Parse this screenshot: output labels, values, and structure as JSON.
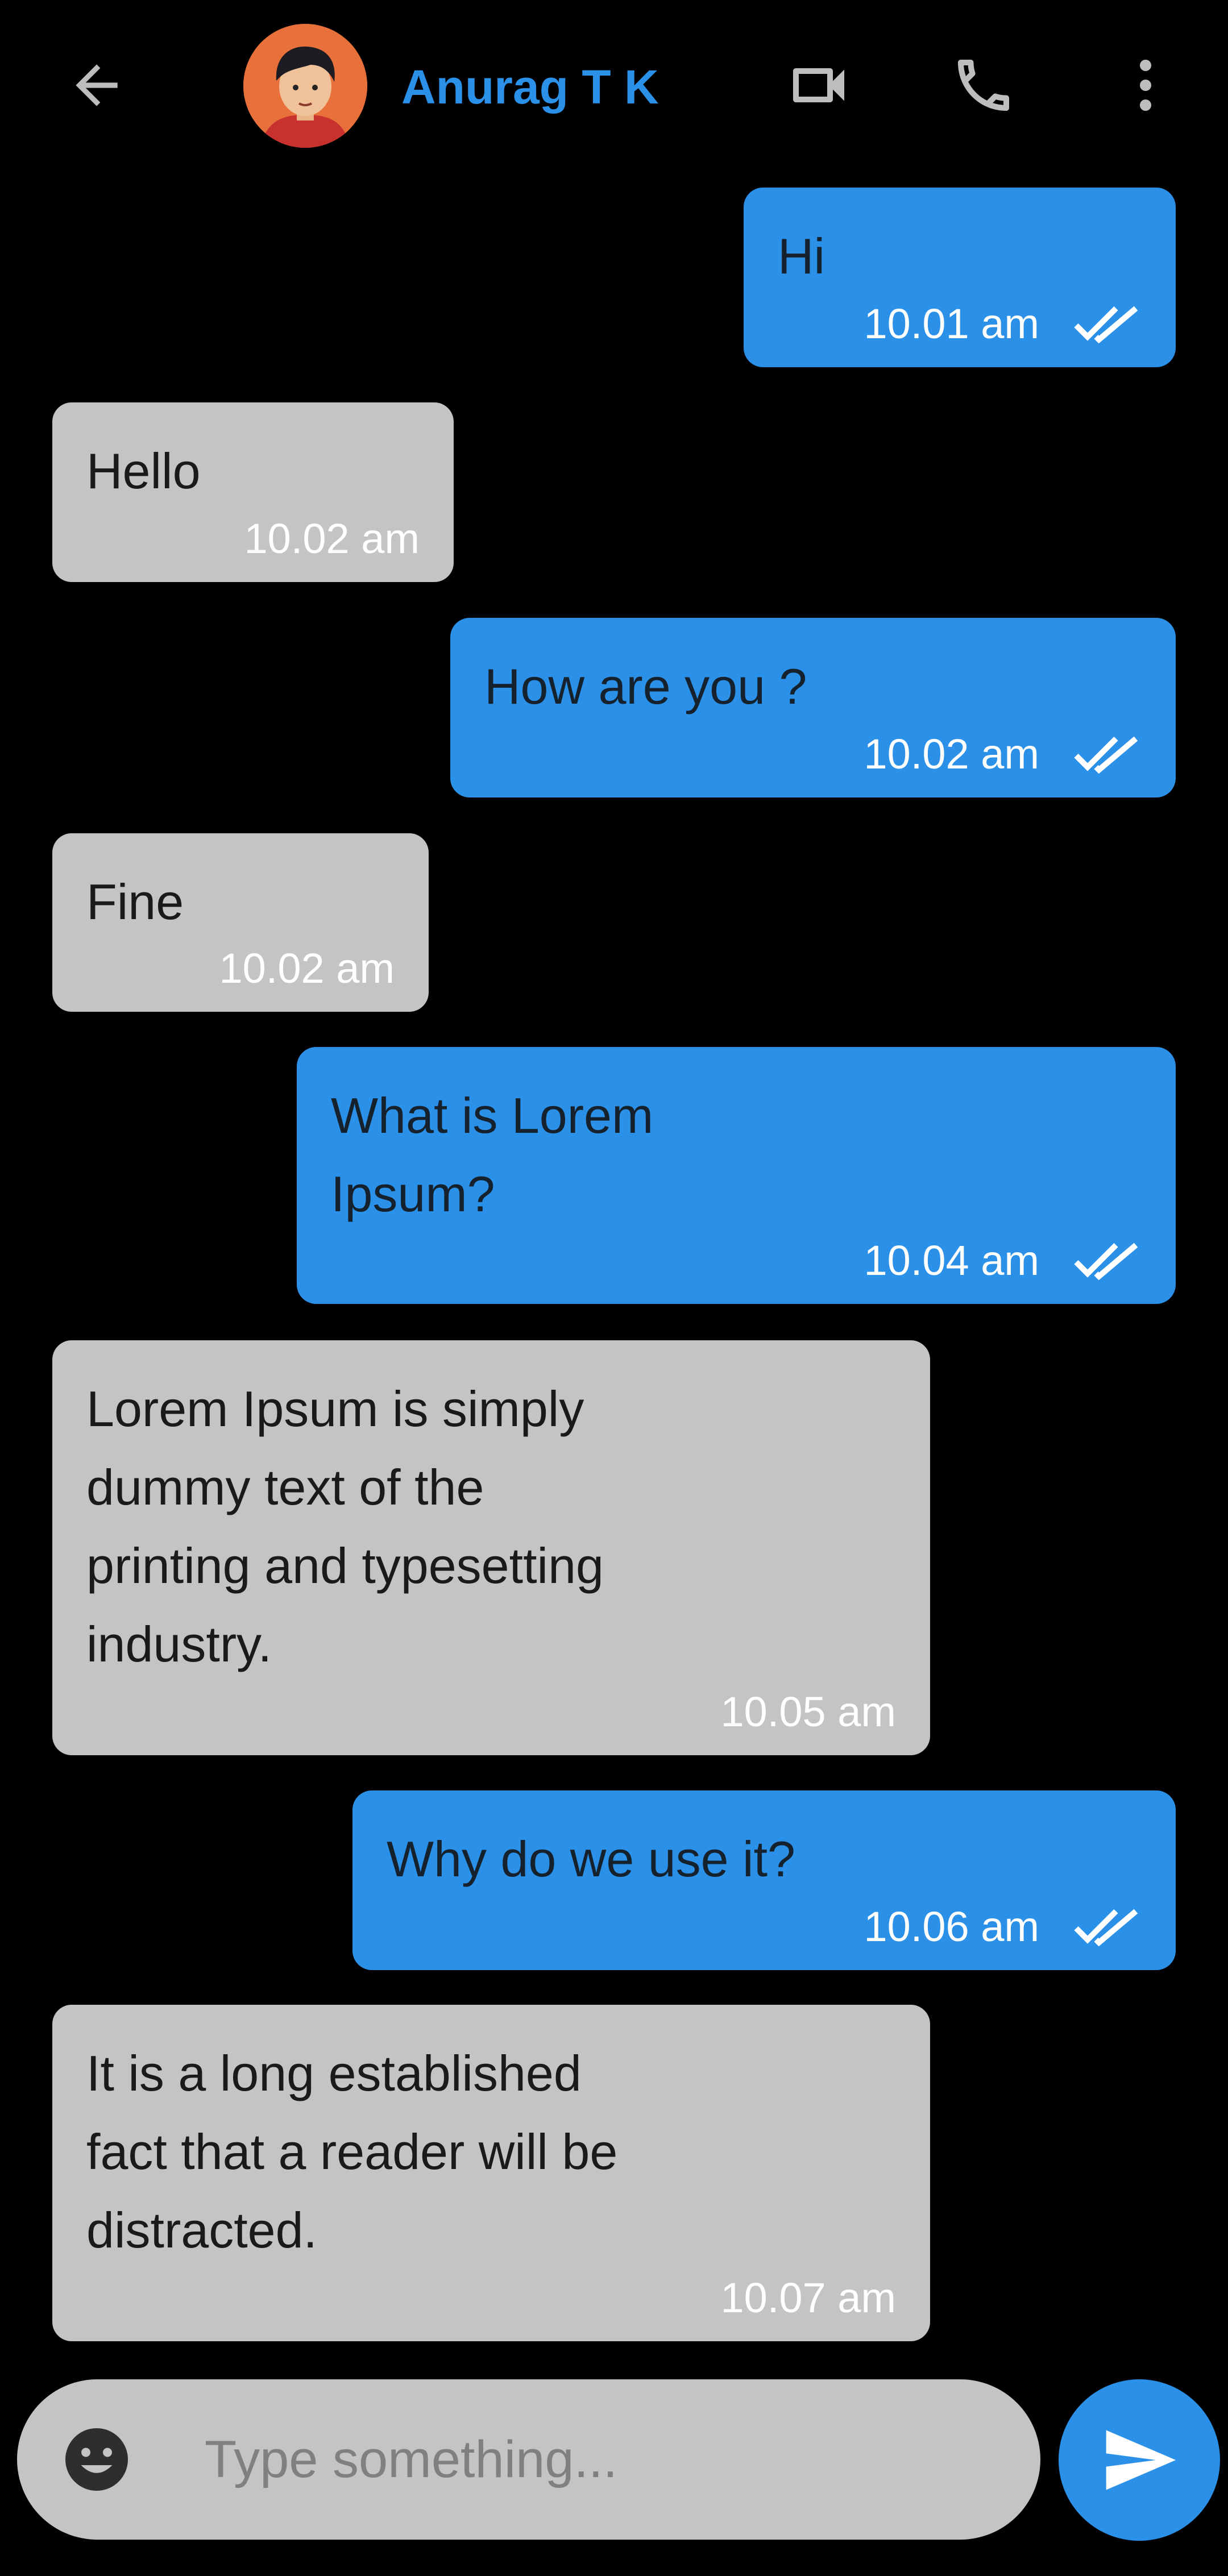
{
  "header": {
    "contact_name": "Anurag T K",
    "accent_color": "#2b90e8",
    "icons": [
      "back-arrow-icon",
      "video-camera-icon",
      "phone-icon",
      "more-vertical-icon"
    ]
  },
  "messages": [
    {
      "direction": "outgoing",
      "lines": [
        "Hi"
      ],
      "time": "10.01 am",
      "status": "read"
    },
    {
      "direction": "incoming",
      "lines": [
        "Hello"
      ],
      "time": "10.02 am"
    },
    {
      "direction": "outgoing",
      "lines": [
        "How are you ?"
      ],
      "time": "10.02 am",
      "status": "read"
    },
    {
      "direction": "incoming",
      "lines": [
        "Fine"
      ],
      "time": "10.02 am"
    },
    {
      "direction": "outgoing",
      "lines": [
        "What is Lorem",
        "Ipsum?"
      ],
      "time": "10.04 am",
      "status": "read"
    },
    {
      "direction": "incoming",
      "lines": [
        "Lorem Ipsum is simply",
        "dummy text of the",
        "printing and typesetting",
        "industry."
      ],
      "time": "10.05 am"
    },
    {
      "direction": "outgoing",
      "lines": [
        "Why do we use it?"
      ],
      "time": "10.06 am",
      "status": "read"
    },
    {
      "direction": "incoming",
      "lines": [
        "It is a long established",
        "fact that a reader will be",
        "distracted."
      ],
      "time": "10.07 am"
    }
  ],
  "composer": {
    "placeholder": "Type something...",
    "value": ""
  },
  "colors": {
    "outgoing_bubble": "#2b90e8",
    "incoming_bubble": "#c4c3c5",
    "background": "#000000"
  }
}
